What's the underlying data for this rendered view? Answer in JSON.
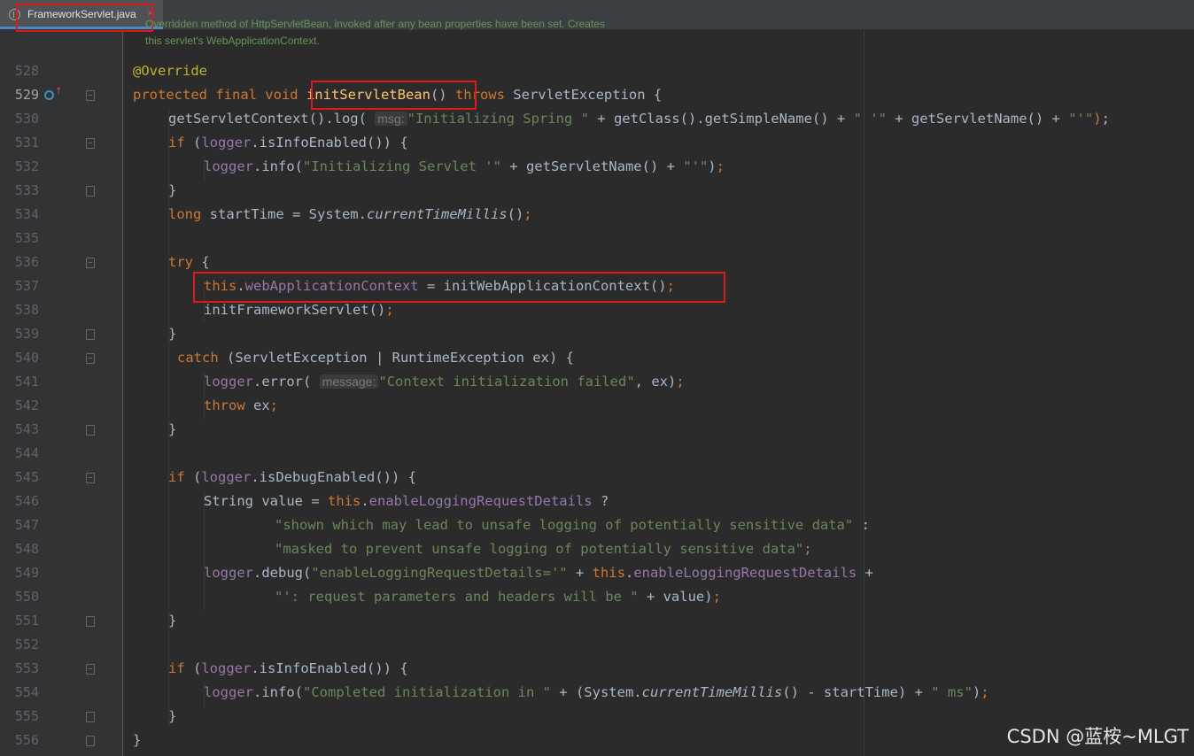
{
  "tab": {
    "label": "FrameworkServlet.java",
    "close": "×"
  },
  "doc_comment": {
    "line1": "Overridden method of HttpServletBean, invoked after any bean properties have been set. Creates",
    "line2": "this servlet's WebApplicationContext."
  },
  "editor": {
    "line_numbers": [
      "528",
      "529",
      "530",
      "531",
      "532",
      "533",
      "534",
      "535",
      "536",
      "537",
      "538",
      "539",
      "540",
      "541",
      "542",
      "543",
      "544",
      "545",
      "546",
      "547",
      "548",
      "549",
      "550",
      "551",
      "552",
      "553",
      "554",
      "555",
      "556"
    ],
    "active_line": "529",
    "hints": {
      "msg": "msg:",
      "message": "message:"
    }
  },
  "highlights": [
    "FrameworkServlet.java tab",
    "initServletBean",
    "this.webApplicationContext = initWebApplicationContext();"
  ],
  "watermark": "CSDN @蓝桉~MLGT",
  "colors": {
    "background": "#2b2b2b",
    "keyword": "#cc7832",
    "string": "#6a8759",
    "field": "#9876aa",
    "annotation": "#bbb529",
    "highlight_box": "#e01818"
  }
}
